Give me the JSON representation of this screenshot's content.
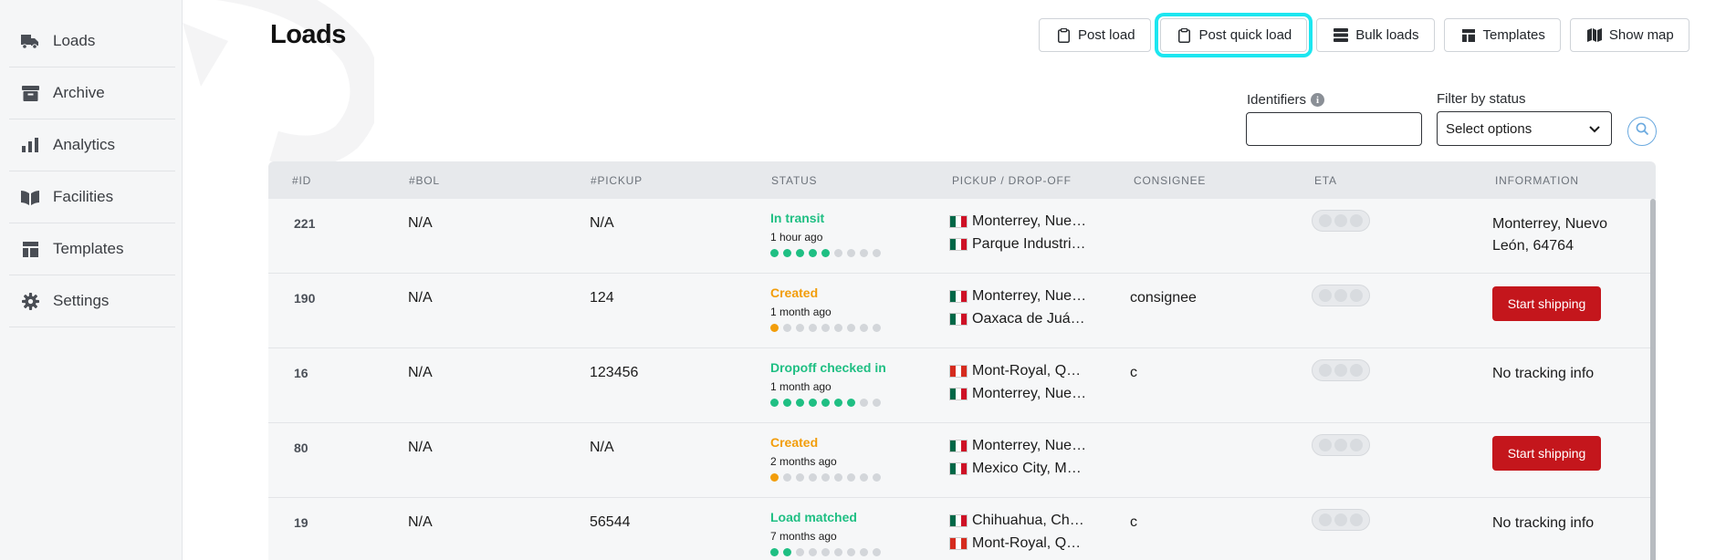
{
  "sidebar": {
    "items": [
      {
        "label": "Loads",
        "icon": "truck-icon"
      },
      {
        "label": "Archive",
        "icon": "archive-icon"
      },
      {
        "label": "Analytics",
        "icon": "bar-chart-icon"
      },
      {
        "label": "Facilities",
        "icon": "book-icon"
      },
      {
        "label": "Templates",
        "icon": "template-icon"
      },
      {
        "label": "Settings",
        "icon": "gear-icon"
      }
    ]
  },
  "page": {
    "title": "Loads"
  },
  "toolbar": {
    "post_load": "Post load",
    "post_quick_load": "Post quick load",
    "bulk_loads": "Bulk loads",
    "templates": "Templates",
    "show_map": "Show map"
  },
  "filters": {
    "identifiers_label": "Identifiers",
    "status_label": "Filter by status",
    "status_value": "Select options"
  },
  "table": {
    "headers": {
      "id": "#ID",
      "bol": "#BOL",
      "pickup": "#PICKUP",
      "status": "STATUS",
      "route": "PICKUP / DROP-OFF",
      "consignee": "CONSIGNEE",
      "eta": "ETA",
      "information": "INFORMATION"
    },
    "rows": [
      {
        "id": "221",
        "bol": "N/A",
        "pickup": "N/A",
        "status": "In transit",
        "status_color": "#1fbf83",
        "time": "1 hour ago",
        "progress_filled": 5,
        "progress_total": 9,
        "origin": "Monterrey, Nue…",
        "origin_flag": "mx",
        "destination": "Parque Industri…",
        "destination_flag": "mx",
        "consignee": "",
        "info_type": "text",
        "info": "Monterrey, Nuevo León, 64764"
      },
      {
        "id": "190",
        "bol": "N/A",
        "pickup": "124",
        "status": "Created",
        "status_color": "#f29d0a",
        "time": "1 month ago",
        "progress_filled": 1,
        "progress_total": 9,
        "origin": "Monterrey, Nue…",
        "origin_flag": "mx",
        "destination": "Oaxaca de Juá…",
        "destination_flag": "mx",
        "consignee": "consignee",
        "info_type": "button",
        "info": "Start shipping"
      },
      {
        "id": "16",
        "bol": "N/A",
        "pickup": "123456",
        "status": "Dropoff checked in",
        "status_color": "#1fbf83",
        "time": "1 month ago",
        "progress_filled": 7,
        "progress_total": 9,
        "origin": "Mont-Royal, Q…",
        "origin_flag": "ca",
        "destination": "Monterrey, Nue…",
        "destination_flag": "mx",
        "consignee": "c",
        "info_type": "text",
        "info": "No tracking info"
      },
      {
        "id": "80",
        "bol": "N/A",
        "pickup": "N/A",
        "status": "Created",
        "status_color": "#f29d0a",
        "time": "2 months ago",
        "progress_filled": 1,
        "progress_total": 9,
        "origin": "Monterrey, Nue…",
        "origin_flag": "mx",
        "destination": "Mexico City, M…",
        "destination_flag": "mx",
        "consignee": "",
        "info_type": "button",
        "info": "Start shipping"
      },
      {
        "id": "19",
        "bol": "N/A",
        "pickup": "56544",
        "status": "Load matched",
        "status_color": "#1fbf83",
        "time": "7 months ago",
        "progress_filled": 2,
        "progress_total": 9,
        "origin": "Chihuahua, Ch…",
        "origin_flag": "mx",
        "destination": "Mont-Royal, Q…",
        "destination_flag": "ca",
        "consignee": "c",
        "info_type": "text",
        "info": "No tracking info"
      }
    ]
  },
  "colors": {
    "accent_red": "#c4161c",
    "success": "#1fbf83",
    "warning": "#f29d0a",
    "highlight": "#1ce6f0"
  }
}
